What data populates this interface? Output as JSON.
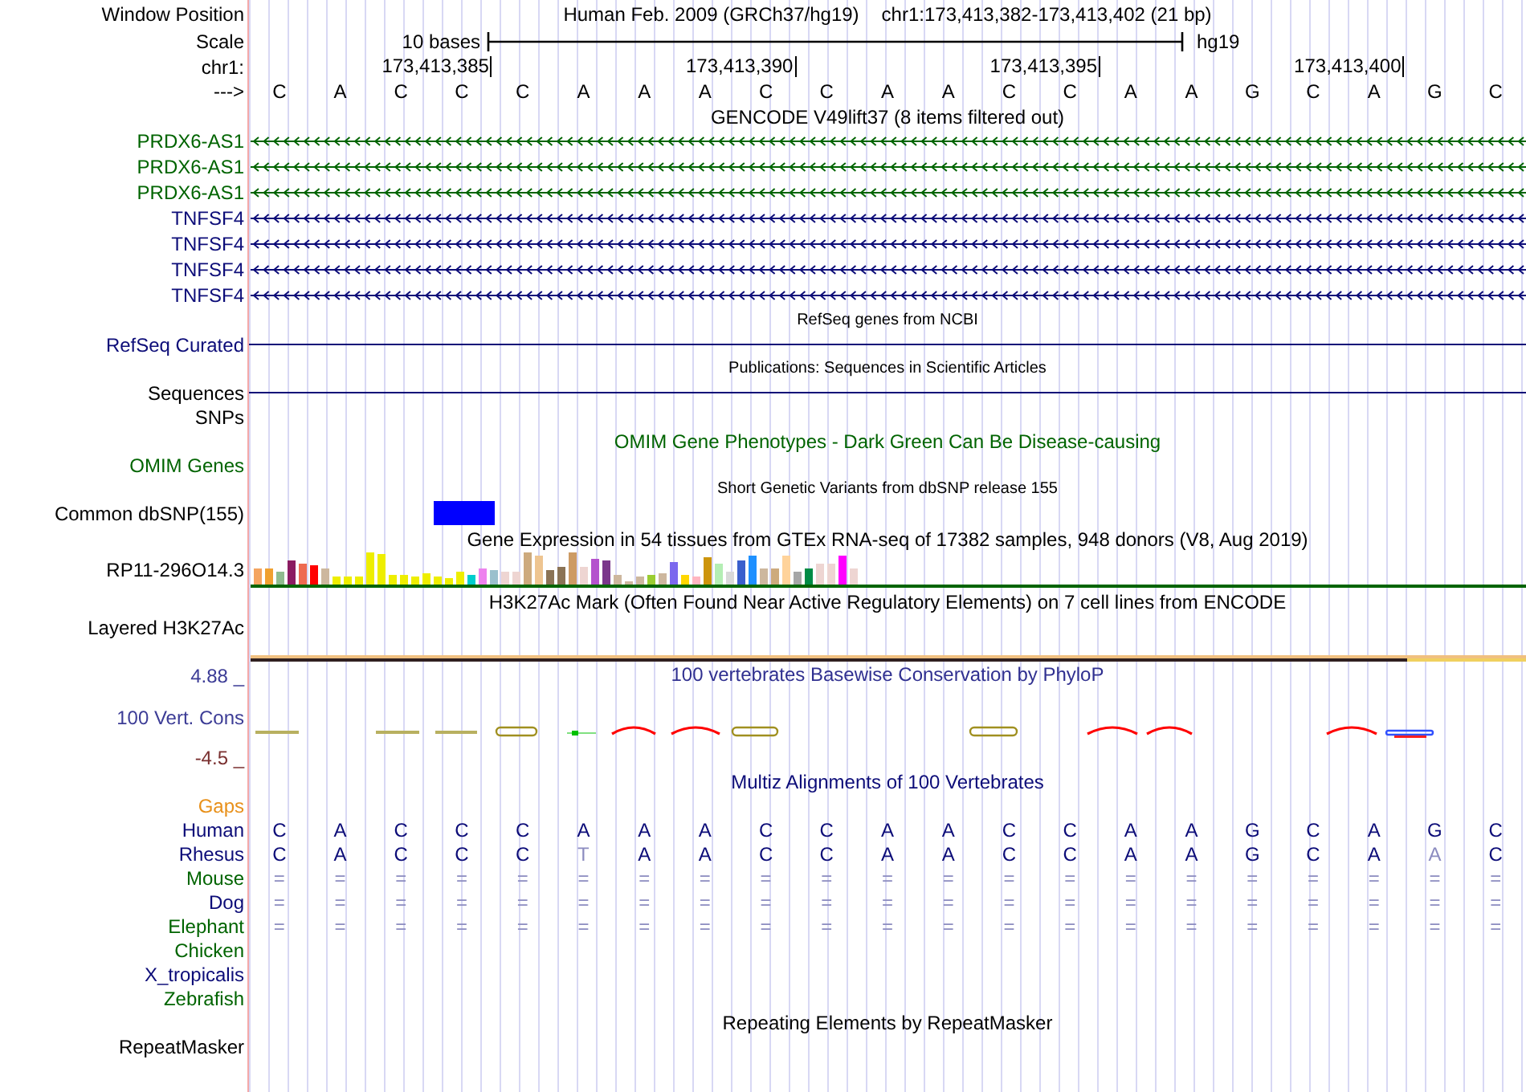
{
  "window_position": {
    "label": "Window Position",
    "assembly": "Human Feb. 2009 (GRCh37/hg19)",
    "range": "chr1:173,413,382-173,413,402 (21 bp)"
  },
  "scale": {
    "label": "Scale",
    "span": "10 bases",
    "assembly": "hg19"
  },
  "ruler": {
    "label": "chr1:",
    "ticks": [
      "173,413,385",
      "173,413,390",
      "173,413,395",
      "173,413,400"
    ]
  },
  "sequence": {
    "label": "--->",
    "bases": [
      "C",
      "A",
      "C",
      "C",
      "C",
      "A",
      "A",
      "A",
      "C",
      "C",
      "A",
      "A",
      "C",
      "C",
      "A",
      "A",
      "G",
      "C",
      "A",
      "G",
      "C"
    ]
  },
  "rows": [
    {
      "kind": "title",
      "text": "GENCODE V49lift37 (8 items filtered out)",
      "color": "#000000"
    },
    {
      "kind": "gene",
      "label": "PRDX6-AS1",
      "color": "#006400"
    },
    {
      "kind": "gene",
      "label": "PRDX6-AS1",
      "color": "#006400"
    },
    {
      "kind": "gene",
      "label": "PRDX6-AS1",
      "color": "#006400"
    },
    {
      "kind": "gene",
      "label": "TNFSF4",
      "color": "#0c0c78"
    },
    {
      "kind": "gene",
      "label": "TNFSF4",
      "color": "#0c0c78"
    },
    {
      "kind": "gene",
      "label": "TNFSF4",
      "color": "#0c0c78"
    },
    {
      "kind": "gene",
      "label": "TNFSF4",
      "color": "#0c0c78"
    },
    {
      "kind": "caption",
      "text": "RefSeq genes from NCBI",
      "color": "#000000"
    },
    {
      "kind": "line",
      "label": "RefSeq Curated",
      "color": "#0c0c78"
    },
    {
      "kind": "caption",
      "text": "Publications: Sequences in Scientific Articles",
      "color": "#000000"
    },
    {
      "kind": "line",
      "label": "Sequences",
      "color": "#000000"
    },
    {
      "kind": "label",
      "label": "SNPs",
      "color": "#000000"
    },
    {
      "kind": "title",
      "text": "OMIM Gene Phenotypes - Dark Green Can Be Disease-causing",
      "color": "#006400"
    },
    {
      "kind": "label",
      "label": "OMIM Genes",
      "color": "#006400"
    },
    {
      "kind": "caption",
      "text": "Short Genetic Variants from dbSNP release 155",
      "color": "#000000"
    },
    {
      "kind": "snp",
      "label": "Common dbSNP(155)",
      "color": "#000000"
    },
    {
      "kind": "title",
      "text": "Gene Expression in 54 tissues from GTEx RNA-seq of 17382 samples, 948 donors (V8, Aug 2019)",
      "color": "#000000"
    },
    {
      "kind": "gtex",
      "label": "RP11-296O14.3",
      "color": "#000000"
    },
    {
      "kind": "title",
      "text": "H3K27Ac Mark (Often Found Near Active Regulatory Elements) on 7 cell lines from ENCODE",
      "color": "#000000"
    },
    {
      "kind": "h3k27ac",
      "label": "Layered H3K27Ac",
      "color": "#000000"
    },
    {
      "kind": "phylop",
      "label": "100 Vert. Cons",
      "color": "#3c3c96",
      "max": "4.88 _",
      "min": "-4.5 _",
      "text": "100 vertebrates Basewise Conservation by PhyloP"
    },
    {
      "kind": "title",
      "text": "Multiz Alignments of 100 Vertebrates",
      "color": "#0c0c78"
    },
    {
      "kind": "label",
      "label": "Gaps",
      "color": "#e8901a"
    },
    {
      "kind": "align",
      "label": "Human",
      "color": "#0c0c78",
      "bases": [
        {
          "text": "C",
          "faded": false
        },
        {
          "text": "A",
          "faded": false
        },
        {
          "text": "C",
          "faded": false
        },
        {
          "text": "C",
          "faded": false
        },
        {
          "text": "C",
          "faded": false
        },
        {
          "text": "A",
          "faded": false
        },
        {
          "text": "A",
          "faded": false
        },
        {
          "text": "A",
          "faded": false
        },
        {
          "text": "C",
          "faded": false
        },
        {
          "text": "C",
          "faded": false
        },
        {
          "text": "A",
          "faded": false
        },
        {
          "text": "A",
          "faded": false
        },
        {
          "text": "C",
          "faded": false
        },
        {
          "text": "C",
          "faded": false
        },
        {
          "text": "A",
          "faded": false
        },
        {
          "text": "A",
          "faded": false
        },
        {
          "text": "G",
          "faded": false
        },
        {
          "text": "C",
          "faded": false
        },
        {
          "text": "A",
          "faded": false
        },
        {
          "text": "G",
          "faded": false
        },
        {
          "text": "C",
          "faded": false
        }
      ]
    },
    {
      "kind": "align",
      "label": "Rhesus",
      "color": "#0c0c78",
      "bases": [
        {
          "text": "C",
          "faded": false
        },
        {
          "text": "A",
          "faded": false
        },
        {
          "text": "C",
          "faded": false
        },
        {
          "text": "C",
          "faded": false
        },
        {
          "text": "C",
          "faded": false
        },
        {
          "text": "T",
          "faded": true
        },
        {
          "text": "A",
          "faded": false
        },
        {
          "text": "A",
          "faded": false
        },
        {
          "text": "C",
          "faded": false
        },
        {
          "text": "C",
          "faded": false
        },
        {
          "text": "A",
          "faded": false
        },
        {
          "text": "A",
          "faded": false
        },
        {
          "text": "C",
          "faded": false
        },
        {
          "text": "C",
          "faded": false
        },
        {
          "text": "A",
          "faded": false
        },
        {
          "text": "A",
          "faded": false
        },
        {
          "text": "G",
          "faded": false
        },
        {
          "text": "C",
          "faded": false
        },
        {
          "text": "A",
          "faded": false
        },
        {
          "text": "A",
          "faded": true
        },
        {
          "text": "C",
          "faded": false
        }
      ]
    },
    {
      "kind": "align",
      "label": "Mouse",
      "color": "#006400",
      "bases": [
        {
          "text": "=",
          "faded": true
        },
        {
          "text": "=",
          "faded": true
        },
        {
          "text": "=",
          "faded": true
        },
        {
          "text": "=",
          "faded": true
        },
        {
          "text": "=",
          "faded": true
        },
        {
          "text": "=",
          "faded": true
        },
        {
          "text": "=",
          "faded": true
        },
        {
          "text": "=",
          "faded": true
        },
        {
          "text": "=",
          "faded": true
        },
        {
          "text": "=",
          "faded": true
        },
        {
          "text": "=",
          "faded": true
        },
        {
          "text": "=",
          "faded": true
        },
        {
          "text": "=",
          "faded": true
        },
        {
          "text": "=",
          "faded": true
        },
        {
          "text": "=",
          "faded": true
        },
        {
          "text": "=",
          "faded": true
        },
        {
          "text": "=",
          "faded": true
        },
        {
          "text": "=",
          "faded": true
        },
        {
          "text": "=",
          "faded": true
        },
        {
          "text": "=",
          "faded": true
        },
        {
          "text": "=",
          "faded": true
        }
      ]
    },
    {
      "kind": "align",
      "label": "Dog",
      "color": "#0c0c78",
      "bases": [
        {
          "text": "=",
          "faded": true
        },
        {
          "text": "=",
          "faded": true
        },
        {
          "text": "=",
          "faded": true
        },
        {
          "text": "=",
          "faded": true
        },
        {
          "text": "=",
          "faded": true
        },
        {
          "text": "=",
          "faded": true
        },
        {
          "text": "=",
          "faded": true
        },
        {
          "text": "=",
          "faded": true
        },
        {
          "text": "=",
          "faded": true
        },
        {
          "text": "=",
          "faded": true
        },
        {
          "text": "=",
          "faded": true
        },
        {
          "text": "=",
          "faded": true
        },
        {
          "text": "=",
          "faded": true
        },
        {
          "text": "=",
          "faded": true
        },
        {
          "text": "=",
          "faded": true
        },
        {
          "text": "=",
          "faded": true
        },
        {
          "text": "=",
          "faded": true
        },
        {
          "text": "=",
          "faded": true
        },
        {
          "text": "=",
          "faded": true
        },
        {
          "text": "=",
          "faded": true
        },
        {
          "text": "=",
          "faded": true
        }
      ]
    },
    {
      "kind": "align",
      "label": "Elephant",
      "color": "#006400",
      "bases": [
        {
          "text": "=",
          "faded": true
        },
        {
          "text": "=",
          "faded": true
        },
        {
          "text": "=",
          "faded": true
        },
        {
          "text": "=",
          "faded": true
        },
        {
          "text": "=",
          "faded": true
        },
        {
          "text": "=",
          "faded": true
        },
        {
          "text": "=",
          "faded": true
        },
        {
          "text": "=",
          "faded": true
        },
        {
          "text": "=",
          "faded": true
        },
        {
          "text": "=",
          "faded": true
        },
        {
          "text": "=",
          "faded": true
        },
        {
          "text": "=",
          "faded": true
        },
        {
          "text": "=",
          "faded": true
        },
        {
          "text": "=",
          "faded": true
        },
        {
          "text": "=",
          "faded": true
        },
        {
          "text": "=",
          "faded": true
        },
        {
          "text": "=",
          "faded": true
        },
        {
          "text": "=",
          "faded": true
        },
        {
          "text": "=",
          "faded": true
        },
        {
          "text": "=",
          "faded": true
        },
        {
          "text": "=",
          "faded": true
        }
      ]
    },
    {
      "kind": "label",
      "label": "Chicken",
      "color": "#006400"
    },
    {
      "kind": "label",
      "label": "X_tropicalis",
      "color": "#0c0c78"
    },
    {
      "kind": "label",
      "label": "Zebrafish",
      "color": "#006400"
    },
    {
      "kind": "title",
      "text": "Repeating Elements by RepeatMasker",
      "color": "#000000"
    },
    {
      "kind": "label",
      "label": "RepeatMasker",
      "color": "#000000"
    }
  ]
}
